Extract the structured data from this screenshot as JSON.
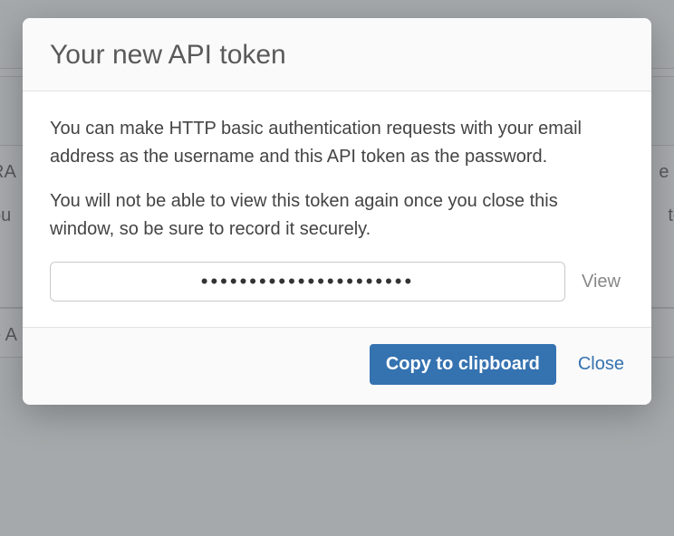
{
  "modal": {
    "title": "Your new API token",
    "paragraph1": "You can make HTTP basic authentication requests with your email address as the username and this API token as the password.",
    "paragraph2": "You will not be able to view this token again once you close this window, so be sure to record it securely.",
    "token_masked": "••••••••••••••••••••••",
    "view_label": "View",
    "copy_label": "Copy to clipboard",
    "close_label": "Close"
  },
  "background": {
    "left1": "RA",
    "left2": "ou",
    "left3": "e A",
    "right1": "e it",
    "right2": "to"
  }
}
